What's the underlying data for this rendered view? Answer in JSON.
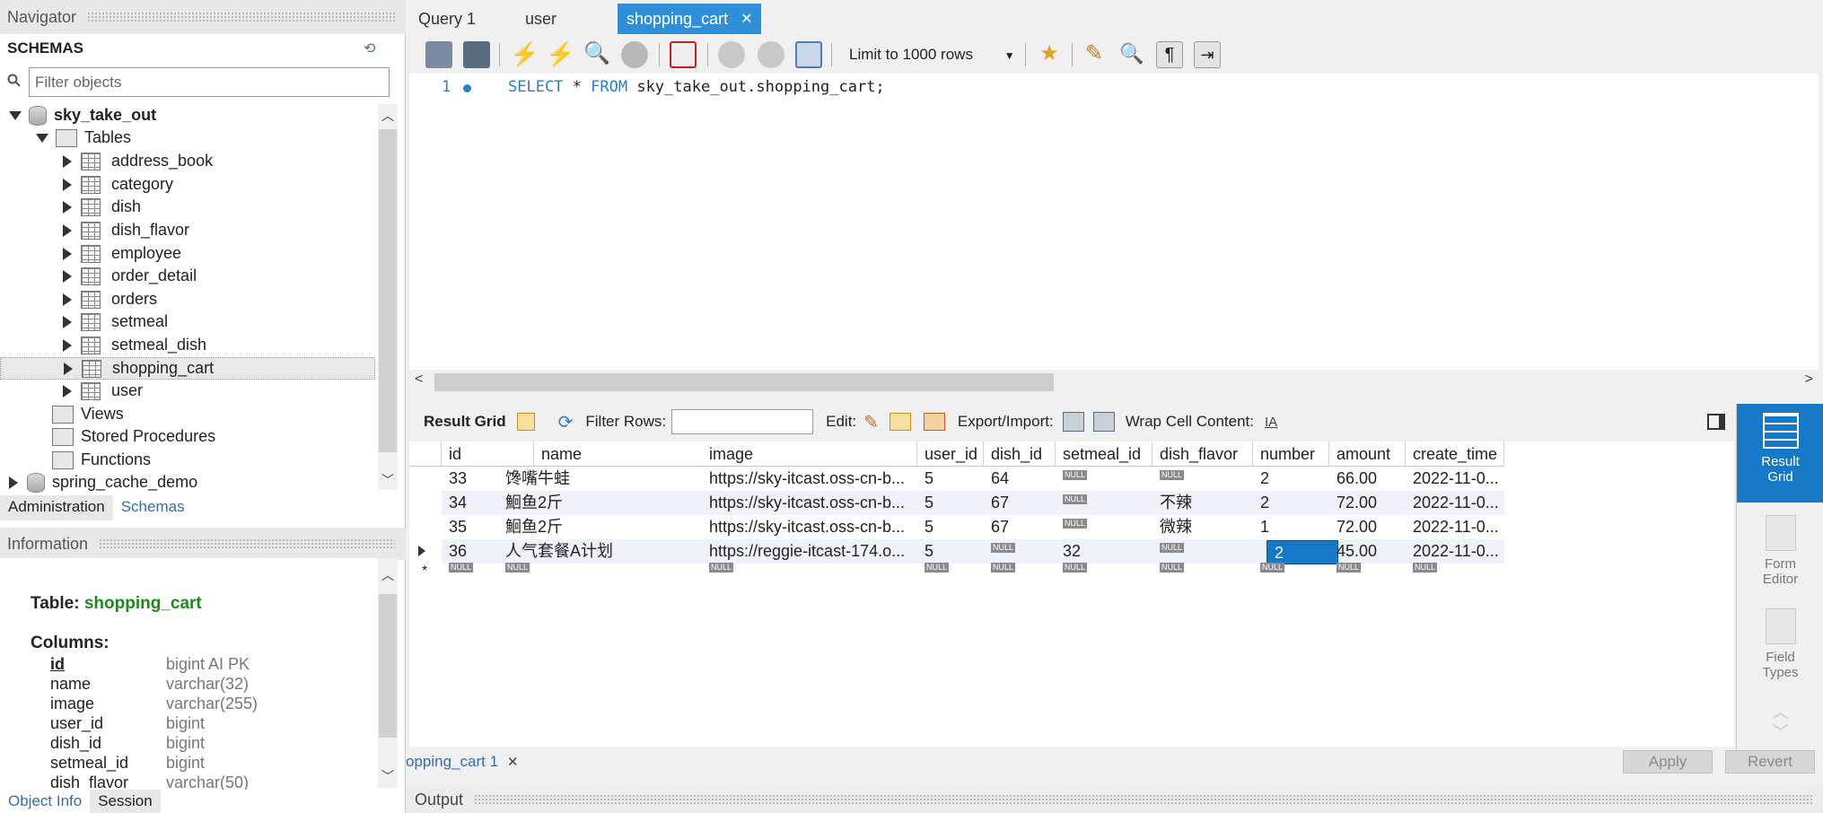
{
  "navigator": {
    "title": "Navigator",
    "schemas_label": "SCHEMAS",
    "filter_placeholder": "Filter objects",
    "tree": {
      "db1": "sky_take_out",
      "tables_label": "Tables",
      "tables": [
        "address_book",
        "category",
        "dish",
        "dish_flavor",
        "employee",
        "order_detail",
        "orders",
        "setmeal",
        "setmeal_dish",
        "shopping_cart",
        "user"
      ],
      "selected_table": "shopping_cart",
      "views_label": "Views",
      "procedures_label": "Stored Procedures",
      "functions_label": "Functions",
      "db2": "spring_cache_demo"
    },
    "tabs": [
      "Administration",
      "Schemas"
    ]
  },
  "information": {
    "title": "Information",
    "table_label": "Table:",
    "table_name": "shopping_cart",
    "columns_label": "Columns:",
    "columns": [
      {
        "name": "id",
        "type": "bigint AI PK"
      },
      {
        "name": "name",
        "type": "varchar(32)"
      },
      {
        "name": "image",
        "type": "varchar(255)"
      },
      {
        "name": "user_id",
        "type": "bigint"
      },
      {
        "name": "dish_id",
        "type": "bigint"
      },
      {
        "name": "setmeal_id",
        "type": "bigint"
      },
      {
        "name": "dish_flavor",
        "type": "varchar(50)"
      }
    ],
    "tabs": [
      "Object Info",
      "Session"
    ]
  },
  "query_tabs": [
    "Query 1",
    "user",
    "shopping_cart"
  ],
  "toolbar": {
    "limit_label": "Limit to 1000 rows"
  },
  "editor": {
    "line_number": "1",
    "sql_select": "SELECT",
    "sql_star": " * ",
    "sql_from": "FROM",
    "sql_rest": " sky_take_out.shopping_cart;"
  },
  "result_toolbar": {
    "result_grid": "Result Grid",
    "filter_rows": "Filter Rows:",
    "edit": "Edit:",
    "export_import": "Export/Import:",
    "wrap": "Wrap Cell Content:"
  },
  "grid": {
    "columns": [
      "id",
      "name",
      "image",
      "user_id",
      "dish_id",
      "setmeal_id",
      "dish_flavor",
      "number",
      "amount",
      "create_time"
    ],
    "rows": [
      [
        "33",
        "馋嘴牛蛙",
        "https://sky-itcast.oss-cn-b...",
        "5",
        "64",
        "NULL",
        "NULL",
        "2",
        "66.00",
        "2022-11-0..."
      ],
      [
        "34",
        "鮰鱼2斤",
        "https://sky-itcast.oss-cn-b...",
        "5",
        "67",
        "NULL",
        "不辣",
        "2",
        "72.00",
        "2022-11-0..."
      ],
      [
        "35",
        "鮰鱼2斤",
        "https://sky-itcast.oss-cn-b...",
        "5",
        "67",
        "NULL",
        "微辣",
        "1",
        "72.00",
        "2022-11-0..."
      ],
      [
        "36",
        "人气套餐A计划",
        "https://reggie-itcast-174.o...",
        "5",
        "NULL",
        "32",
        "NULL",
        "2",
        "45.00",
        "2022-11-0..."
      ]
    ],
    "null_label": "NULL",
    "new_row_marker": "*"
  },
  "side_panel": {
    "result_grid": "Result Grid",
    "form_editor": "Form Editor",
    "field_types": "Field Types"
  },
  "bottom": {
    "result_tab": "opping_cart 1",
    "apply": "Apply",
    "revert": "Revert",
    "output": "Output"
  }
}
